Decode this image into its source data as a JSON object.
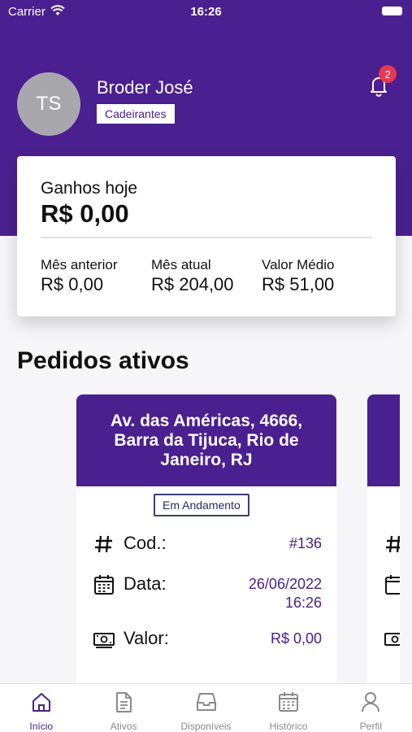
{
  "status_bar": {
    "carrier": "Carrier",
    "time": "16:26"
  },
  "profile": {
    "initials": "TS",
    "name": "Broder José",
    "badge": "Cadeirantes",
    "notifications_count": "2"
  },
  "earnings": {
    "today_label": "Ganhos hoje",
    "today_value": "R$ 0,00",
    "stats": [
      {
        "label": "Mês anterior",
        "value": "R$ 0,00"
      },
      {
        "label": "Mês atual",
        "value": "R$ 204,00"
      },
      {
        "label": "Valor Médio",
        "value": "R$ 51,00"
      }
    ]
  },
  "section_title": "Pedidos ativos",
  "orders": [
    {
      "address": "Av. das Américas, 4666, Barra da Tijuca, Rio de Janeiro, RJ",
      "status": "Em Andamento",
      "code_label": "Cod.:",
      "code_value": "#136",
      "date_label": "Data:",
      "date_value": "26/06/2022",
      "time_value": "16:26",
      "value_label": "Valor:",
      "value_value": "R$ 0,00"
    }
  ],
  "tabs": [
    {
      "label": "Início",
      "icon": "home-icon",
      "active": true
    },
    {
      "label": "Ativos",
      "icon": "document-icon",
      "active": false
    },
    {
      "label": "Disponíveis",
      "icon": "inbox-icon",
      "active": false
    },
    {
      "label": "Histórico",
      "icon": "calendar-icon",
      "active": false
    },
    {
      "label": "Perfil",
      "icon": "person-icon",
      "active": false
    }
  ],
  "colors": {
    "primary": "#4a2090",
    "badge": "#e53950",
    "background": "#f6f6f8"
  }
}
